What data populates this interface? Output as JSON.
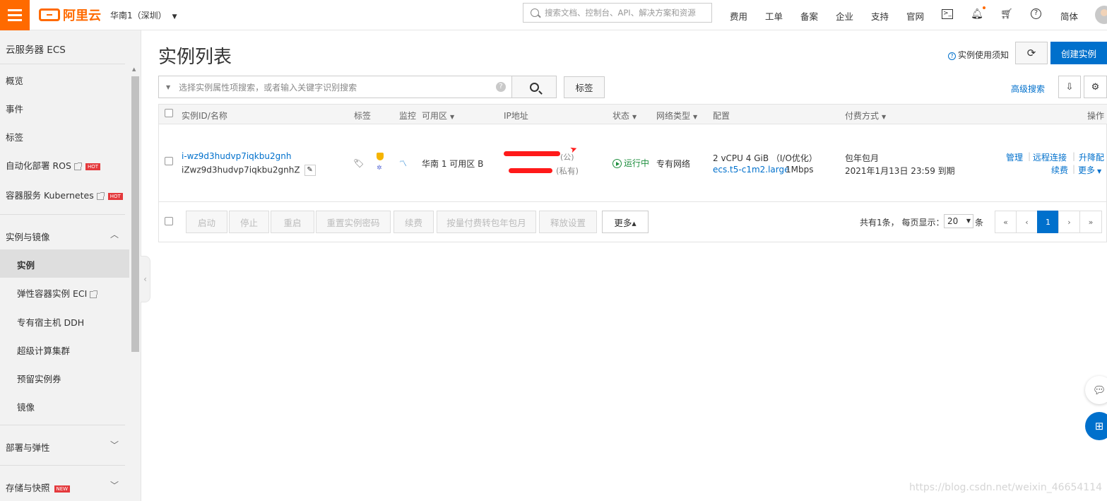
{
  "header": {
    "logo": "阿里云",
    "region": "华南1（深圳）",
    "search_placeholder": "搜索文档、控制台、API、解决方案和资源",
    "nav": [
      "费用",
      "工单",
      "备案",
      "企业",
      "支持",
      "官网"
    ],
    "lang": "简体"
  },
  "sidebar": {
    "title": "云服务器 ECS",
    "items": [
      "概览",
      "事件",
      "标签",
      "自动化部署 ROS",
      "容器服务 Kubernetes"
    ],
    "hot": "HOT",
    "new": "NEW",
    "group1": "实例与镜像",
    "sub_items": [
      "实例",
      "弹性容器实例 ECI",
      "专有宿主机 DDH",
      "超级计算集群",
      "预留实例券",
      "镜像"
    ],
    "group2": "部署与弹性",
    "group3": "存储与快照"
  },
  "main": {
    "title": "实例列表",
    "notice": "实例使用须知",
    "create": "创建实例",
    "filter_placeholder": "选择实例属性项搜索，或者输入关键字识别搜索",
    "tag_btn": "标签",
    "advanced": "高级搜索"
  },
  "table": {
    "headers": {
      "id": "实例ID/名称",
      "tag": "标签",
      "monitor": "监控",
      "zone": "可用区",
      "ip": "IP地址",
      "status": "状态",
      "network": "网络类型",
      "config": "配置",
      "billing": "付费方式",
      "ops": "操作"
    },
    "row": {
      "id": "i-wz9d3hudvp7iqkbu2gnh",
      "name": "iZwz9d3hudvp7iqkbu2gnhZ",
      "zone": "华南 1 可用区 B",
      "ip_public_suffix": "(公)",
      "ip_private_suffix": "(私有)",
      "status": "运行中",
      "network": "专有网络",
      "config1": "2 vCPU 4 GiB （I/O优化）",
      "config_type": "ecs.t5-c1m2.large",
      "bandwidth": "1Mbps",
      "billing1": "包年包月",
      "billing2": "2021年1月13日 23:59 到期",
      "op_manage": "管理",
      "op_remote": "远程连接",
      "op_upgrade": "升降配",
      "op_renew": "续费",
      "op_more": "更多"
    }
  },
  "bulk": {
    "start": "启动",
    "stop": "停止",
    "restart": "重启",
    "reset_pwd": "重置实例密码",
    "renew": "续费",
    "convert": "按量付费转包年包月",
    "release": "释放设置",
    "more": "更多▴"
  },
  "pager": {
    "total_text": "共有1条，  每页显示：",
    "page_size": "20",
    "unit": "条",
    "current": "1"
  },
  "watermark": "https://blog.csdn.net/weixin_46654114",
  "colors": {
    "brand": "#ff6a00",
    "primary": "#0070cc"
  }
}
